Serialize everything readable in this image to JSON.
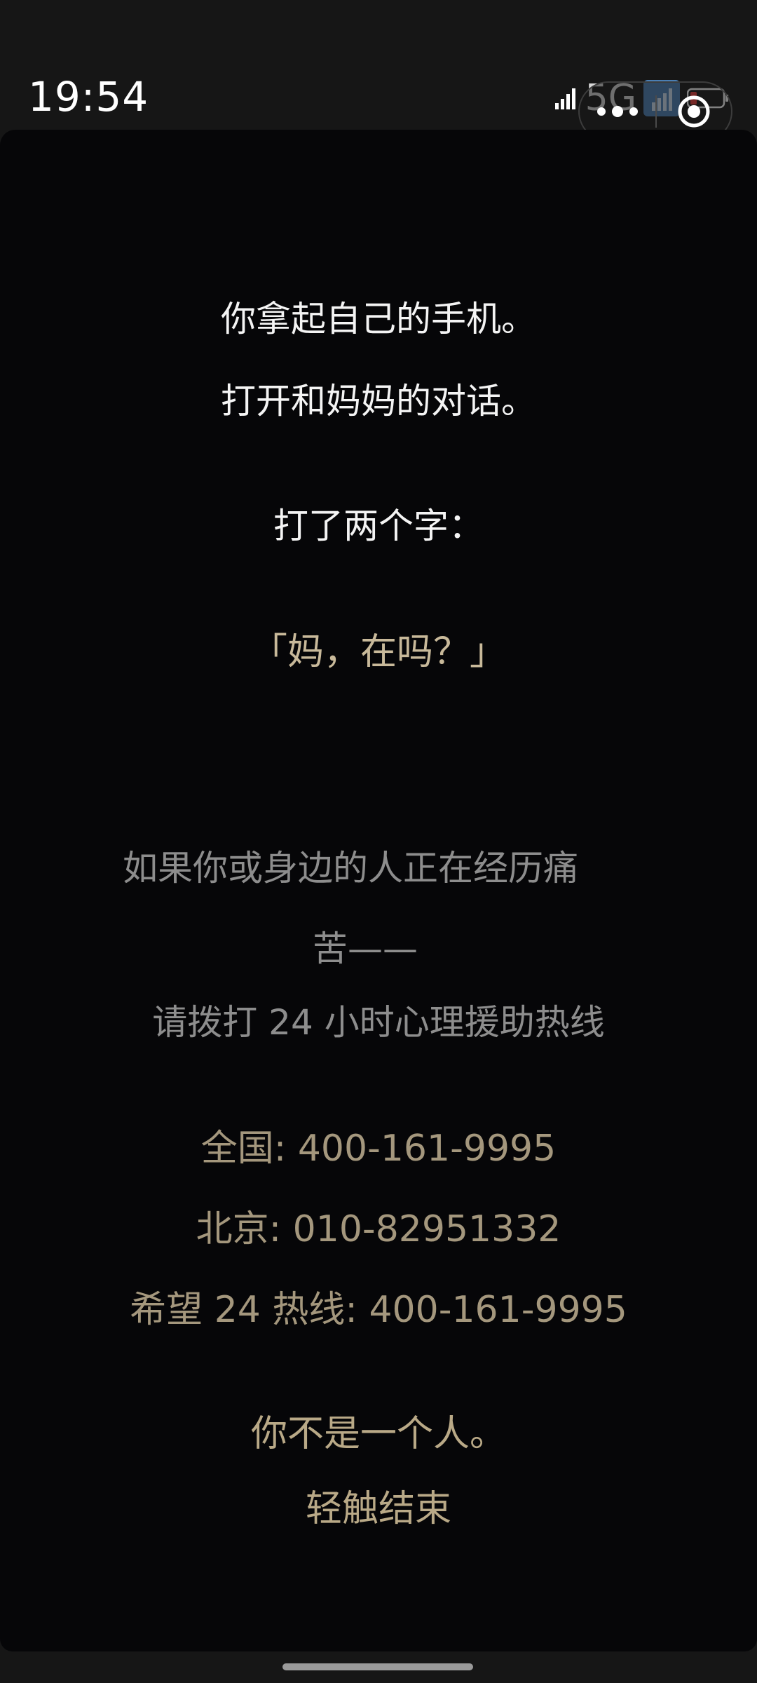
{
  "status_bar": {
    "time": "19:54",
    "network": "5G",
    "icons": [
      "signal-icon",
      "wifi-box-icon",
      "battery-icon"
    ]
  },
  "capsule": {
    "icons": [
      "more-dots-icon",
      "close-target-icon"
    ]
  },
  "story": {
    "line1": "你拿起自己的手机。",
    "line2": "打开和妈妈的对话。",
    "line3": "打了两个字：",
    "quote": "「妈，在吗？」"
  },
  "help": {
    "line1": "如果你或身边的人正在经历痛",
    "line2": "苦——",
    "line3": "请拨打 24 小时心理援助热线"
  },
  "hotlines": [
    "全国: 400-161-9995",
    "北京: 010-82951332",
    "希望 24 热线: 400-161-9995"
  ],
  "closing": {
    "message": "你不是一个人。",
    "end_label": "轻触结束"
  },
  "colors": {
    "background": "#060608",
    "status_bar": "#161616",
    "story_text": "#f4f4f4",
    "accent_gold": "#c8b99a",
    "help_text": "#8d8d8d"
  }
}
